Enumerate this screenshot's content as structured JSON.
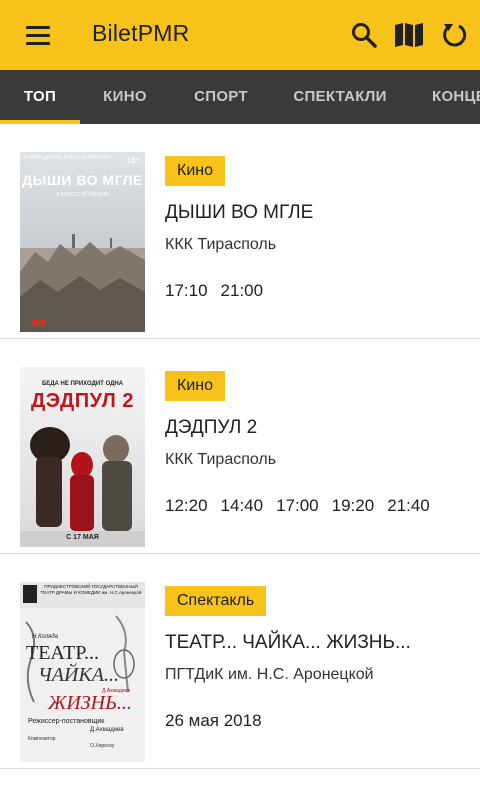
{
  "app": {
    "title": "BiletPMR"
  },
  "icons": {
    "menu": "hamburger-menu-icon",
    "search": "search-icon",
    "map": "map-icon",
    "refresh": "refresh-icon"
  },
  "colors": {
    "accent": "#f7c31b",
    "tabs_bg": "#3a3a3a",
    "tab_active": "#ffffff",
    "tab_inactive": "#c8c8c8"
  },
  "tabs": [
    {
      "label": "ТОП",
      "active": true
    },
    {
      "label": "КИНО"
    },
    {
      "label": "СПОРТ"
    },
    {
      "label": "СПЕКТАКЛИ"
    },
    {
      "label": "КОНЦЕ"
    }
  ],
  "events": [
    {
      "category": "Кино",
      "title": "ДЫШИ ВО МГЛЕ",
      "place": "ККК Тирасполь",
      "times": [
        "17:10",
        "21:00"
      ],
      "poster": {
        "top_text": "РОМЕН ДЮРИС   ОЛЬГА КУРИЛЕНКО",
        "title": "ДЫШИ ВО МГЛЕ",
        "subtitle": "В КИНО С 26 АПРЕЛЯ",
        "rating": "16+"
      }
    },
    {
      "category": "Кино",
      "title": "ДЭДПУЛ 2",
      "place": "ККК Тирасполь",
      "times": [
        "12:20",
        "14:40",
        "17:00",
        "19:20",
        "21:40"
      ],
      "poster": {
        "top_text": "БЕДА НЕ ПРИХОДИТ ОДНА",
        "title": "ДЭДПУЛ 2",
        "bottom_text": "С 17 МАЯ"
      }
    },
    {
      "category": "Спектакль",
      "title": "ТЕАТР... ЧАЙКА... ЖИЗНЬ...",
      "place": "ПГТДиК им. Н.С. Аронецкой",
      "date": "26 мая 2018",
      "poster": {
        "header": "ПРИДНЕСТРОВСКИЙ ГОСУДАРСТВЕННЫЙ ТЕАТР ДРАМЫ И КОМЕДИИ им. Н.С.Аронецкой",
        "author": "Н.Коляда",
        "line1": "ТЕАТР...",
        "line2": "ЧАЙКА...",
        "line3": "ЖИЗНЬ...",
        "credit": "Д.Ахмадиев",
        "director_label": "Режиссер-постановщик",
        "director": "Д.Ахмадиев",
        "composer_label": "Композитор",
        "composer": "О.Хереску"
      }
    }
  ]
}
